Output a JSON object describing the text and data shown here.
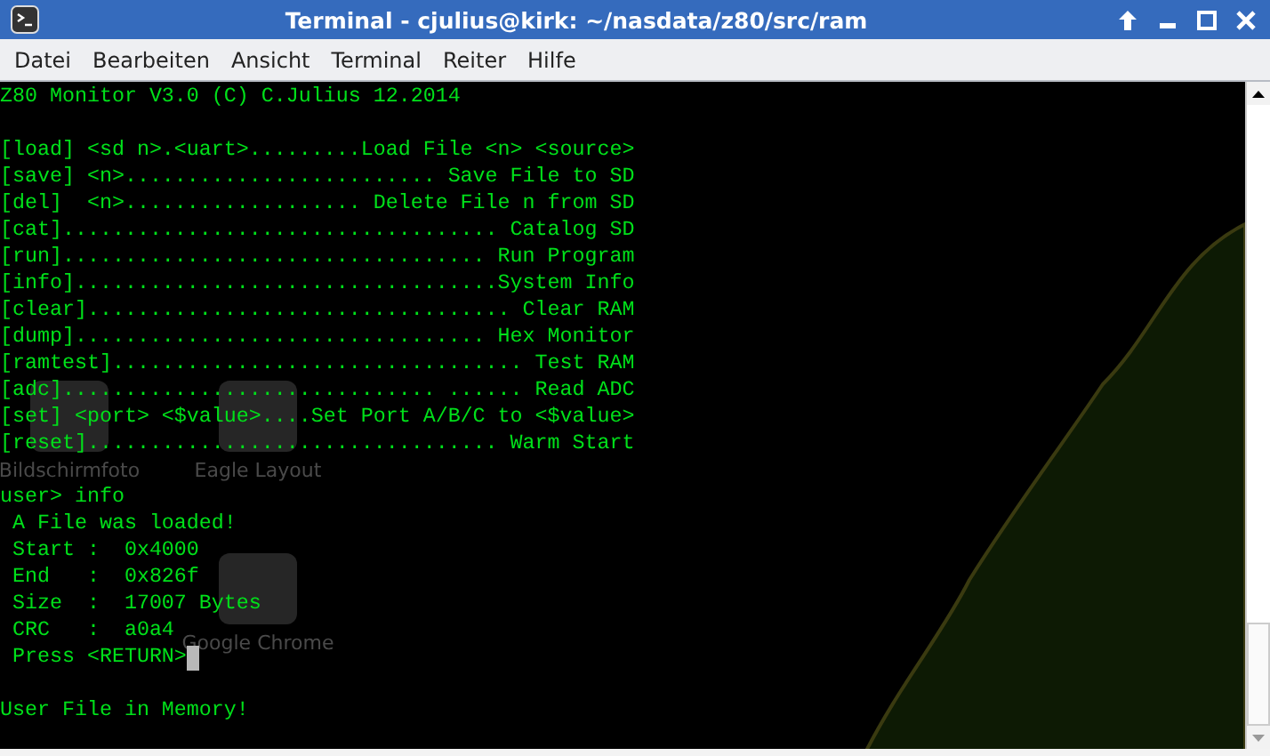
{
  "window": {
    "title": "Terminal - cjulius@kirk: ~/nasdata/z80/src/ram"
  },
  "menu": [
    "Datei",
    "Bearbeiten",
    "Ansicht",
    "Terminal",
    "Reiter",
    "Hilfe"
  ],
  "desktop_icons": [
    {
      "label": "Bildschirmfoto"
    },
    {
      "label": "Eagle Layout"
    },
    {
      "label": "Google Chrome"
    }
  ],
  "terminal_lines": [
    {
      "kind": "text",
      "text": "Z80 Monitor V3.0 (C) C.Julius 12.2014",
      "cursor": false
    },
    {
      "kind": "blank"
    },
    {
      "kind": "text",
      "text": "[load] <sd n>.<uart>.........Load File <n> <source>",
      "cursor": false
    },
    {
      "kind": "text",
      "text": "[save] <n>......................... Save File to SD",
      "cursor": false
    },
    {
      "kind": "text",
      "text": "[del]  <n>................... Delete File n from SD",
      "cursor": false
    },
    {
      "kind": "text",
      "text": "[cat]................................... Catalog SD",
      "cursor": false
    },
    {
      "kind": "text",
      "text": "[run].................................. Run Program",
      "cursor": false
    },
    {
      "kind": "text",
      "text": "[info]..................................System Info",
      "cursor": false
    },
    {
      "kind": "text",
      "text": "[clear].................................. Clear RAM",
      "cursor": false
    },
    {
      "kind": "text",
      "text": "[dump]................................. Hex Monitor",
      "cursor": false
    },
    {
      "kind": "text",
      "text": "[ramtest]................................. Test RAM",
      "cursor": false
    },
    {
      "kind": "text",
      "text": "[adc].............................. ...... Read ADC",
      "cursor": false
    },
    {
      "kind": "text",
      "text": "[set] <port> <$value>....Set Port A/B/C to <$value>",
      "cursor": false
    },
    {
      "kind": "text",
      "text": "[reset]................................. Warm Start",
      "cursor": false
    },
    {
      "kind": "blank"
    },
    {
      "kind": "text",
      "text": "user> info",
      "cursor": false
    },
    {
      "kind": "text",
      "text": " A File was loaded!",
      "cursor": false
    },
    {
      "kind": "text",
      "text": " Start :  0x4000",
      "cursor": false
    },
    {
      "kind": "text",
      "text": " End   :  0x826f",
      "cursor": false
    },
    {
      "kind": "text",
      "text": " Size  :  17007 Bytes",
      "cursor": false
    },
    {
      "kind": "text",
      "text": " CRC   :  a0a4",
      "cursor": false
    },
    {
      "kind": "text",
      "text": " Press <RETURN>",
      "cursor": true
    },
    {
      "kind": "blank"
    },
    {
      "kind": "text",
      "text": "User File in Memory!",
      "cursor": false
    }
  ]
}
